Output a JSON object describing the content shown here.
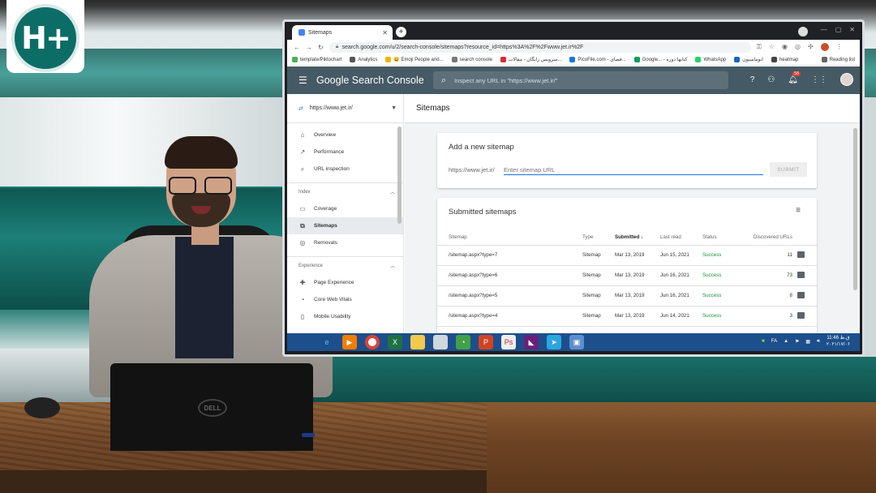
{
  "logo": {
    "text": "H+"
  },
  "browser": {
    "tab_title": "Sitemaps",
    "url": "search.google.com/u/2/search-console/sitemaps?resource_id=https%3A%2F%2Fwww.jet.ir%2F",
    "bookmarks": [
      "template/Piktochart",
      "Analytics",
      "😀 Emoji People and...",
      "search console",
      "سرویس رایگان - مقالات...",
      "PicoFile.com - فضای...",
      "Google... - کتابها دوره",
      "WhatsApp",
      "انوماسیون",
      "heatmap"
    ],
    "reading_list": "Reading list"
  },
  "gsc": {
    "product": "Google Search Console",
    "search_placeholder": "Inspect any URL in \"https://www.jet.ir/\"",
    "notif_count": "58",
    "property": "https://www.jet.ir/",
    "page_title": "Sitemaps"
  },
  "sidebar": {
    "items": [
      {
        "label": "Overview",
        "icon": "home-icon"
      },
      {
        "label": "Performance",
        "icon": "trend-icon"
      },
      {
        "label": "URL inspection",
        "icon": "search-icon"
      }
    ],
    "index_label": "Index",
    "index_items": [
      {
        "label": "Coverage",
        "icon": "coverage-icon"
      },
      {
        "label": "Sitemaps",
        "icon": "sitemap-icon"
      },
      {
        "label": "Removals",
        "icon": "removals-icon"
      }
    ],
    "experience_label": "Experience",
    "experience_items": [
      {
        "label": "Page Experience",
        "icon": "page-experience-icon"
      },
      {
        "label": "Core Web Vitals",
        "icon": "vitals-icon"
      },
      {
        "label": "Mobile Usability",
        "icon": "mobile-icon"
      }
    ]
  },
  "add_sitemap": {
    "title": "Add a new sitemap",
    "prefix": "https://www.jet.ir/",
    "placeholder": "Enter sitemap URL",
    "submit": "SUBMIT"
  },
  "submitted": {
    "title": "Submitted sitemaps",
    "columns": [
      "Sitemap",
      "Type",
      "Submitted",
      "Last read",
      "Status",
      "Discovered URLs"
    ],
    "rows": [
      {
        "sitemap": "/sitemap.aspx?type=7",
        "type": "Sitemap",
        "submitted": "Mar 13, 2019",
        "last_read": "Jun 15, 2021",
        "status": "Success",
        "urls": "11"
      },
      {
        "sitemap": "/sitemap.aspx?type=6",
        "type": "Sitemap",
        "submitted": "Mar 13, 2019",
        "last_read": "Jun 16, 2021",
        "status": "Success",
        "urls": "73"
      },
      {
        "sitemap": "/sitemap.aspx?type=5",
        "type": "Sitemap",
        "submitted": "Mar 13, 2019",
        "last_read": "Jun 16, 2021",
        "status": "Success",
        "urls": "8"
      },
      {
        "sitemap": "/sitemap.aspx?type=4",
        "type": "Sitemap",
        "submitted": "Mar 13, 2019",
        "last_read": "Jun 14, 2021",
        "status": "Success",
        "urls": "3"
      }
    ]
  },
  "taskbar": {
    "lang": "FA",
    "time": "11:46 ق.ظ",
    "date": "۲۰۲۱/۱۷/۰۶"
  },
  "colors": {
    "gsc_header": "#455a64",
    "success": "#1e8e3e",
    "link_blue": "#1a73e8",
    "studio_teal": "#0e5e58"
  }
}
